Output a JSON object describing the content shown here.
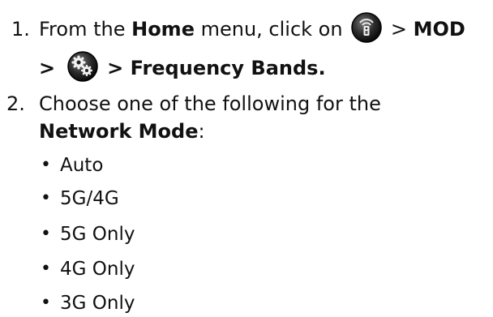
{
  "step1": {
    "number": "1.",
    "text_before": "From the ",
    "home_label": "Home",
    "text_menu": " menu, click on ",
    "sep1": " > ",
    "mod_label": "MOD",
    "sep2": ">",
    "sep3": " > ",
    "frequency_bands_label": "Frequency Bands.",
    "icons": [
      "router-settings-icon",
      "gears-icon"
    ]
  },
  "step2": {
    "number": "2.",
    "text_line1": "Choose one of the following for the",
    "network_mode_label": "Network Mode",
    "colon": ":",
    "options": [
      "Auto",
      "5G/4G",
      "5G Only",
      "4G Only",
      "3G Only"
    ]
  }
}
